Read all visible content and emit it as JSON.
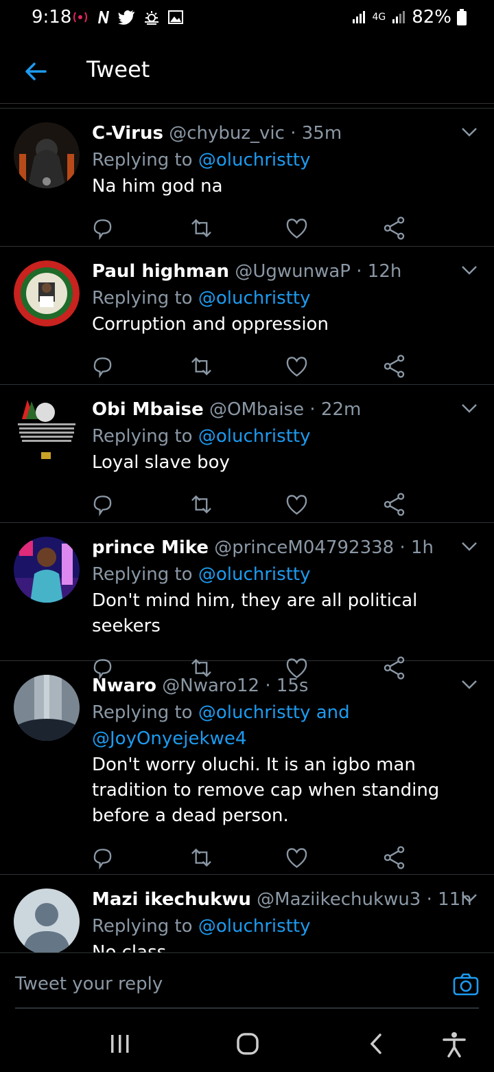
{
  "status": {
    "time": "9:18",
    "left_icons": [
      "wireless-icon",
      "n-icon",
      "twitter-icon",
      "weather-icon",
      "image-icon"
    ],
    "network": "4G",
    "battery": "82%"
  },
  "header": {
    "title": "Tweet"
  },
  "tweets": [
    {
      "name": "C-Virus",
      "handle": "@chybuz_vic",
      "time": "· 35m",
      "reply_prefix": "Replying to",
      "reply_to": "@oluchristty",
      "reply_to_2": "",
      "text": "Na him god na"
    },
    {
      "name": "Paul highman",
      "handle": "@UgwunwaP",
      "time": "· 12h",
      "reply_prefix": "Replying to",
      "reply_to": "@oluchristty",
      "reply_to_2": "",
      "text": "Corruption and oppression"
    },
    {
      "name": "Obi Mbaise",
      "handle": "@OMbaise",
      "time": "· 22m",
      "reply_prefix": "Replying to",
      "reply_to": "@oluchristty",
      "reply_to_2": "",
      "text": "Loyal slave boy"
    },
    {
      "name": "prince Mike",
      "handle": "@princeM04792338",
      "time": "· 1h",
      "reply_prefix": "Replying to",
      "reply_to": "@oluchristty",
      "reply_to_2": "",
      "text": "Don't mind him, they are all political seekers"
    },
    {
      "name": "Nwaro",
      "handle": "@Nwaro12",
      "time": "· 15s",
      "reply_prefix": "Replying to",
      "reply_to": "@oluchristty and",
      "reply_to_2": "@JoyOnyejekwe4",
      "text": "Don't worry oluchi. It is an igbo man tradition to remove cap when standing before a dead person."
    },
    {
      "name": "Mazi ikechukwu",
      "handle": "@Maziikechukwu3",
      "time": "· 11h",
      "reply_prefix": "Replying to",
      "reply_to": "@oluchristty",
      "reply_to_2": "",
      "text": "No class"
    }
  ],
  "reply_bar": {
    "placeholder": "Tweet your reply"
  },
  "colors": {
    "accent": "#1d9bf0",
    "background": "#000000",
    "secondary_text": "#8b98a5"
  }
}
